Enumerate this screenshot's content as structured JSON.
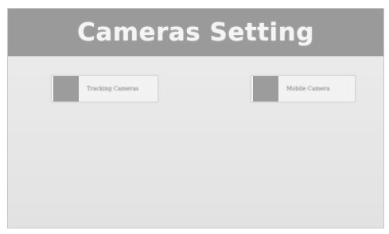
{
  "header": {
    "title": "Cameras Setting"
  },
  "options": [
    {
      "label": "Tracking Cameras"
    },
    {
      "label": "Mobile Camera"
    }
  ],
  "colors": {
    "header_bg": "#9a9a9a",
    "title_text": "#f4f4f4",
    "swatch": "#9c9c9c",
    "panel_bg": "#e9e9e9"
  }
}
